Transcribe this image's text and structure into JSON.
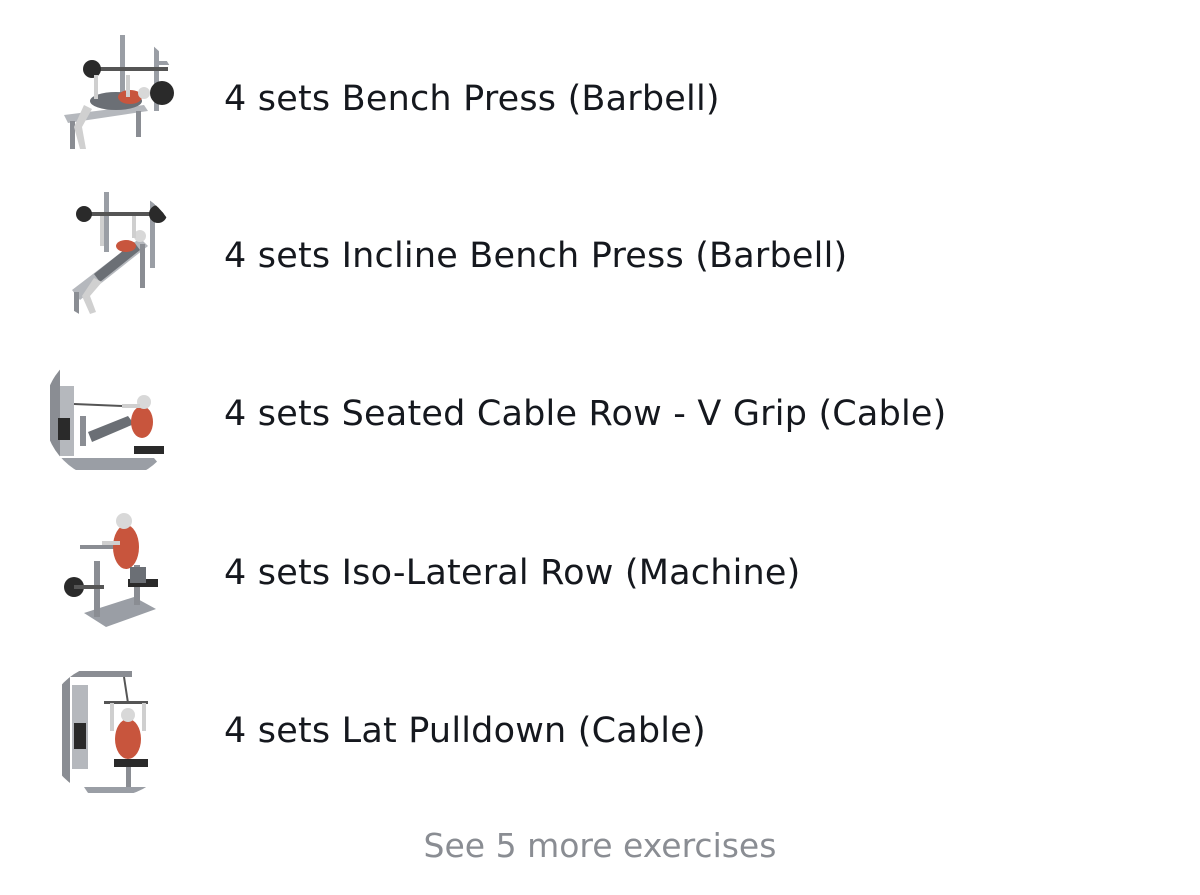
{
  "exercises": [
    {
      "label": "4 sets Bench Press (Barbell)",
      "icon": "bench-press-illustration"
    },
    {
      "label": "4 sets Incline Bench Press (Barbell)",
      "icon": "incline-bench-press-illustration"
    },
    {
      "label": "4 sets Seated Cable Row - V Grip (Cable)",
      "icon": "seated-cable-row-illustration"
    },
    {
      "label": "4 sets Iso-Lateral Row (Machine)",
      "icon": "iso-lateral-row-illustration"
    },
    {
      "label": "4 sets Lat Pulldown (Cable)",
      "icon": "lat-pulldown-illustration"
    }
  ],
  "see_more": {
    "label": "See 5 more exercises"
  },
  "colors": {
    "text": "#15181e",
    "muted": "#8a8d93",
    "muscle_highlight": "#c8553d",
    "equipment": "#9a9ea5"
  }
}
